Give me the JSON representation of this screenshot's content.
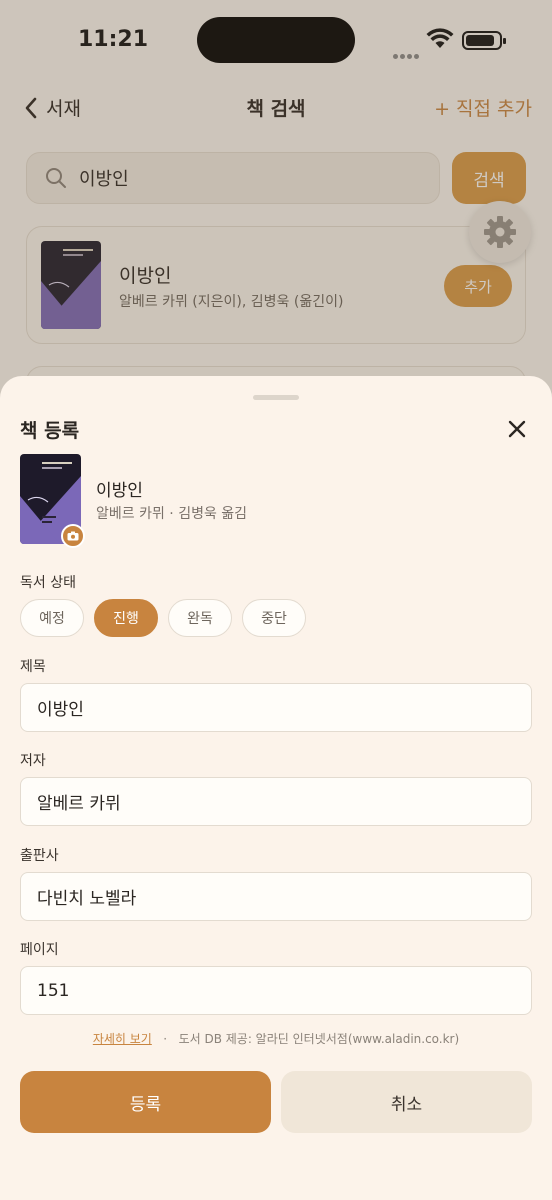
{
  "status_bar": {
    "time": "11:21"
  },
  "nav": {
    "back_label": "서재",
    "title": "책 검색",
    "right_action": "+ 직접 추가"
  },
  "search": {
    "query": "이방인",
    "button_label": "검색"
  },
  "results": [
    {
      "title": "이방인",
      "author": "알베르 카뮈 (지은이), 김병욱 (옮긴이)",
      "add_label": "추가"
    }
  ],
  "sheet": {
    "title": "책 등록",
    "book": {
      "title": "이방인",
      "meta": "알베르 카뮈 · 김병욱 옮김"
    },
    "reading_status": {
      "label": "독서 상태",
      "options": [
        "예정",
        "진행",
        "완독",
        "중단"
      ],
      "selected": "진행"
    },
    "fields": {
      "title": {
        "label": "제목",
        "value": "이방인"
      },
      "author": {
        "label": "저자",
        "value": "알베르 카뮈"
      },
      "publisher": {
        "label": "출판사",
        "value": "다빈치 노벨라"
      },
      "pages": {
        "label": "페이지",
        "value": "151"
      }
    },
    "credit": {
      "more_link": "자세히 보기",
      "separator": "·",
      "text": "도서 DB 제공: 알라딘 인터넷서점(www.aladin.co.kr)"
    },
    "register_label": "등록",
    "cancel_label": "취소"
  },
  "colors": {
    "accent": "#c8843f",
    "button_gold": "#d99a45",
    "sheet_bg": "#fcf3ea",
    "cover_purple": "#7b68b8"
  }
}
